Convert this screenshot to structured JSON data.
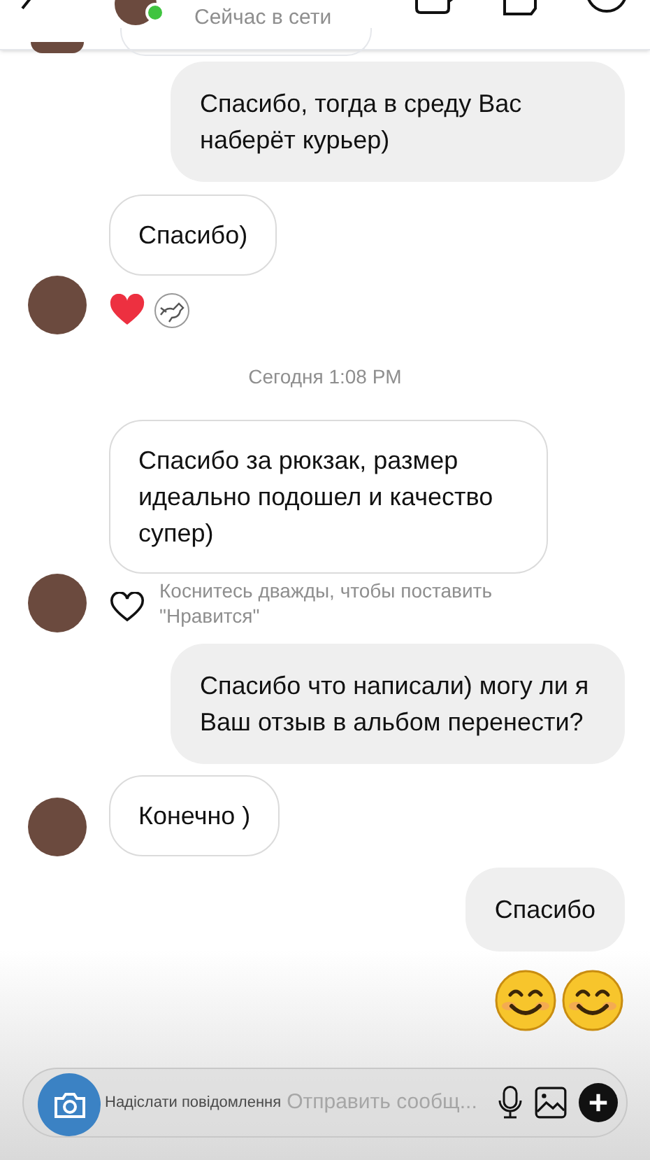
{
  "header": {
    "status": "Сейчас в сети",
    "online": true
  },
  "messages": [
    {
      "kind": "outgoing",
      "text": "Спасибо, тогда в среду Вас наберёт курьер)"
    },
    {
      "kind": "incoming",
      "text": "Спасибо)",
      "avatar": false
    },
    {
      "kind": "reactions"
    },
    {
      "kind": "timestamp",
      "text": "Сегодня 1:08 PM"
    },
    {
      "kind": "incoming",
      "text": "Спасибо за рюкзак, размер идеально подошел и качество супер)",
      "avatar": false
    },
    {
      "kind": "hint",
      "text": "Коснитесь дважды, чтобы поставить \"Нравится\""
    },
    {
      "kind": "outgoing",
      "text": "Спасибо что написали) могу ли я Ваш отзыв в альбом перенести?"
    },
    {
      "kind": "incoming",
      "text": "Конечно )",
      "avatar": true
    },
    {
      "kind": "outgoing",
      "text": "Спасибо"
    },
    {
      "kind": "emoji_pair"
    }
  ],
  "composer": {
    "placeholder": "Отправить сообщ...",
    "overlay_text": "Надіслати повідомлення"
  }
}
